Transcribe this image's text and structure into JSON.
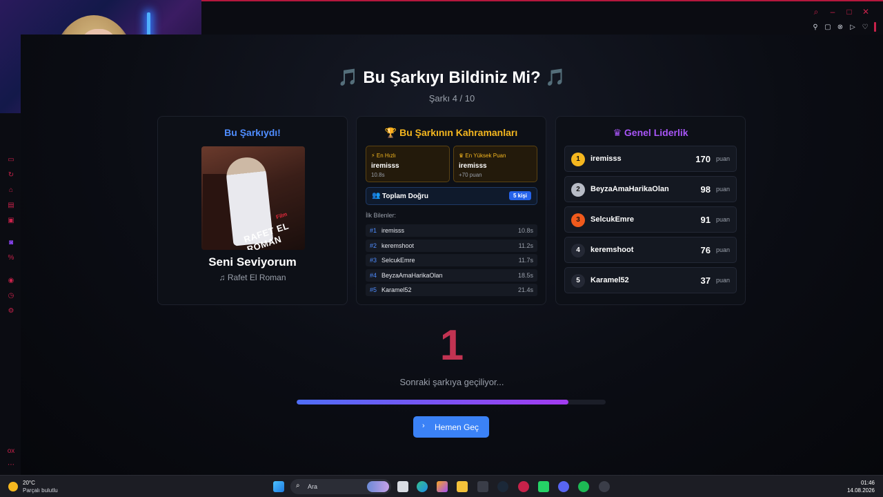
{
  "header": {
    "title": "Bu Şarkıyı Bildiniz Mi?",
    "note_glyph": "🎵",
    "progress": "Şarkı 4 / 10"
  },
  "song_card": {
    "heading": "Bu Şarkıydı!",
    "cover_text": "RAFET EL ROMAN",
    "cover_tag": "Film",
    "title": "Seni Seviyorum",
    "artist": "Rafet El Roman"
  },
  "heroes_card": {
    "heading": "Bu Şarkının Kahramanları",
    "fastest": {
      "label": "En Hızlı",
      "name": "iremisss",
      "detail": "10.8s"
    },
    "top_score": {
      "label": "En Yüksek Puan",
      "name": "iremisss",
      "detail": "+70 puan"
    },
    "total": {
      "label": "Toplam Doğru",
      "badge": "5 kişi"
    },
    "first_knowers_label": "İlk Bilenler:",
    "first_knowers": [
      {
        "rank": "#1",
        "name": "iremisss",
        "time": "10.8s"
      },
      {
        "rank": "#2",
        "name": "keremshoot",
        "time": "11.2s"
      },
      {
        "rank": "#3",
        "name": "SelcukEmre",
        "time": "11.7s"
      },
      {
        "rank": "#4",
        "name": "BeyzaAmaHarikaOlan",
        "time": "18.5s"
      },
      {
        "rank": "#5",
        "name": "Karamel52",
        "time": "21.4s"
      }
    ]
  },
  "leaderboard_card": {
    "heading": "Genel Liderlik",
    "unit": "puan",
    "rows": [
      {
        "rank": "1",
        "name": "iremisss",
        "points": "170",
        "color": "#f5b71f"
      },
      {
        "rank": "2",
        "name": "BeyzaAmaHarikaOlan",
        "points": "98",
        "color": "#b8bcc6"
      },
      {
        "rank": "3",
        "name": "SelcukEmre",
        "points": "91",
        "color": "#f05a1c"
      },
      {
        "rank": "4",
        "name": "keremshoot",
        "points": "76",
        "color": "#242834"
      },
      {
        "rank": "5",
        "name": "Karamel52",
        "points": "37",
        "color": "#242834"
      }
    ]
  },
  "countdown": {
    "value": "1",
    "message": "Sonraki şarkıya geçiliyor...",
    "progress_fraction": 0.88,
    "skip_label": "Hemen Geç"
  },
  "taskbar": {
    "temperature": "20°C",
    "condition": "Parçalı bulutlu",
    "search_placeholder": "Ara",
    "time": "01:46",
    "date": "14.08.2026"
  },
  "colors": {
    "accent_blue": "#3b82f6",
    "accent_gold": "#f5b71f",
    "accent_purple": "#a855f7",
    "countdown_red": "#c23352"
  }
}
